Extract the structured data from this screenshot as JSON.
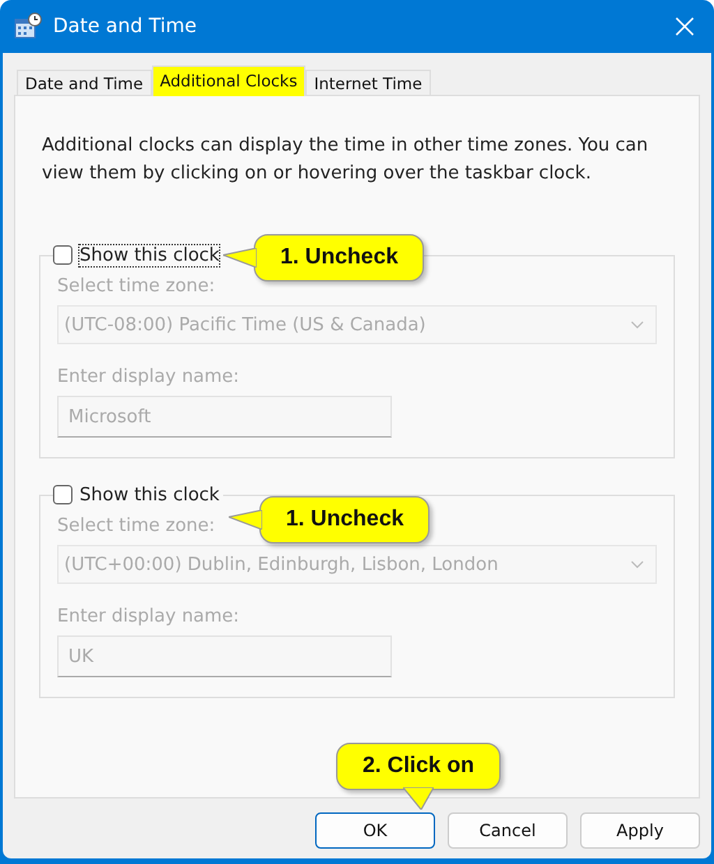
{
  "window": {
    "title": "Date and Time"
  },
  "tabs": [
    {
      "label": "Date and Time",
      "selected": false,
      "highlighted": false
    },
    {
      "label": "Additional Clocks",
      "selected": true,
      "highlighted": true
    },
    {
      "label": "Internet Time",
      "selected": false,
      "highlighted": false
    }
  ],
  "description": "Additional clocks can display the time in other time zones. You can view them by clicking on or hovering over the taskbar clock.",
  "clocks": [
    {
      "checkbox_label": "Show this clock",
      "checked": false,
      "focused": true,
      "zone_label": "Select time zone:",
      "zone": "(UTC-08:00) Pacific Time (US & Canada)",
      "name_label": "Enter display name:",
      "display_name": "Microsoft"
    },
    {
      "checkbox_label": "Show this clock",
      "checked": false,
      "focused": false,
      "zone_label": "Select time zone:",
      "zone": "(UTC+00:00) Dublin, Edinburgh, Lisbon, London",
      "name_label": "Enter display name:",
      "display_name": "UK"
    }
  ],
  "buttons": [
    {
      "label": "OK",
      "default": true
    },
    {
      "label": "Cancel",
      "default": false
    },
    {
      "label": "Apply",
      "default": false
    }
  ],
  "callouts": [
    {
      "text": "1. Uncheck",
      "kind": "left"
    },
    {
      "text": "1. Uncheck",
      "kind": "left"
    },
    {
      "text": "2. Click on",
      "kind": "down"
    }
  ]
}
